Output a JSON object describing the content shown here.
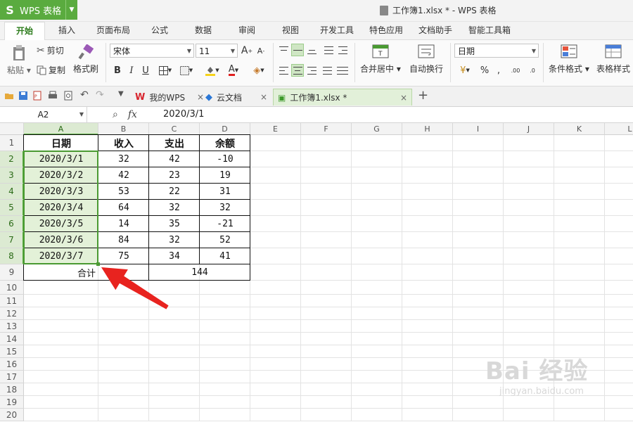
{
  "app": {
    "name": "WPS 表格",
    "window_title": "工作簿1.xlsx * - WPS 表格"
  },
  "menu": {
    "tabs": [
      "开始",
      "插入",
      "页面布局",
      "公式",
      "数据",
      "审阅",
      "视图",
      "开发工具",
      "特色应用",
      "文档助手",
      "智能工具箱"
    ],
    "active": "开始"
  },
  "ribbon": {
    "paste": "粘贴",
    "cut": "剪切",
    "copy": "复制",
    "format_painter": "格式刷",
    "font_name": "宋体",
    "font_size": "11",
    "merge_center": "合并居中",
    "wrap_text": "自动换行",
    "number_format": "日期",
    "conditional_format": "条件格式",
    "table_style": "表格样式"
  },
  "doc_tabs": [
    {
      "label": "我的WPS",
      "active": false
    },
    {
      "label": "云文档",
      "active": false
    },
    {
      "label": "工作簿1.xlsx *",
      "active": true
    }
  ],
  "formula_bar": {
    "name_box": "A2",
    "fx": "fx",
    "value": "2020/3/1"
  },
  "colors": {
    "accent": "#5aab3f",
    "selection_fill": "#e3f1d8",
    "arrow": "#e8231f"
  },
  "sheet": {
    "columns": [
      "A",
      "B",
      "C",
      "D",
      "E",
      "F",
      "G",
      "H",
      "I",
      "J",
      "K",
      "L"
    ],
    "rows": [
      "1",
      "2",
      "3",
      "4",
      "5",
      "6",
      "7",
      "8",
      "9",
      "10",
      "11",
      "12",
      "13",
      "14",
      "15",
      "16",
      "17",
      "18",
      "19",
      "20"
    ],
    "headers": [
      "日期",
      "收入",
      "支出",
      "余额"
    ],
    "data": [
      [
        "2020/3/1",
        "32",
        "42",
        "-10"
      ],
      [
        "2020/3/2",
        "42",
        "23",
        "19"
      ],
      [
        "2020/3/3",
        "53",
        "22",
        "31"
      ],
      [
        "2020/3/4",
        "64",
        "32",
        "32"
      ],
      [
        "2020/3/5",
        "14",
        "35",
        "-21"
      ],
      [
        "2020/3/6",
        "84",
        "32",
        "52"
      ],
      [
        "2020/3/7",
        "75",
        "34",
        "41"
      ]
    ],
    "total_label": "合计",
    "total_value": "144"
  },
  "watermark": {
    "text": "Bai 经验",
    "sub": "jingyan.baidu.com"
  }
}
